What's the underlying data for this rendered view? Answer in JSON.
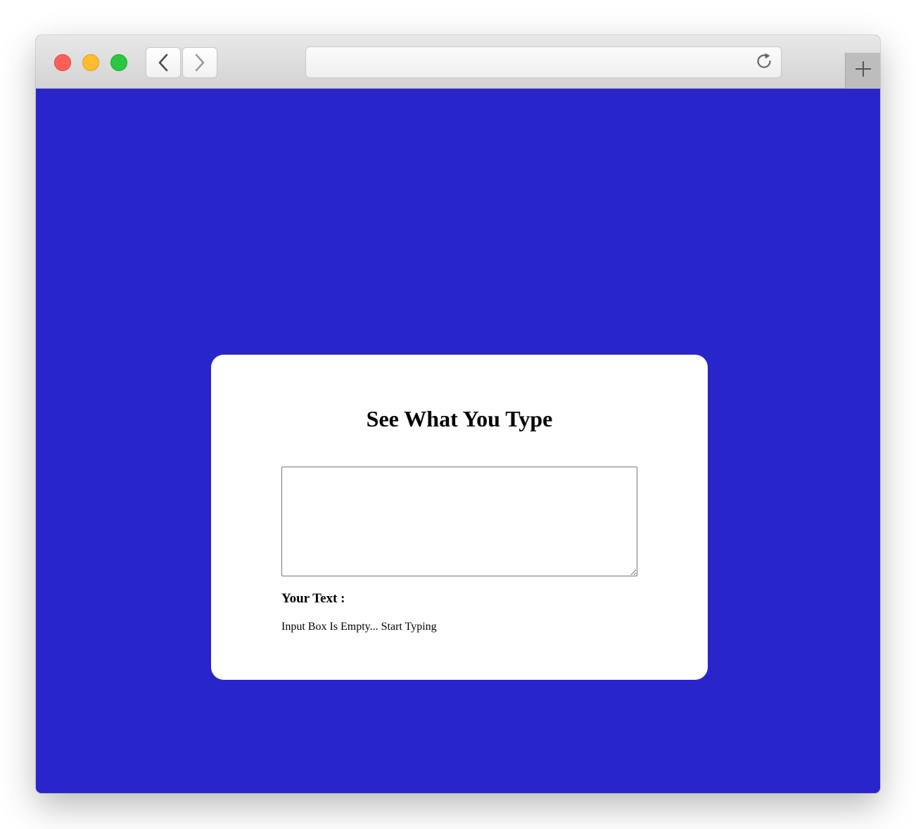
{
  "browser": {
    "url": "",
    "icons": {
      "close": "close-window-icon",
      "minimize": "minimize-window-icon",
      "maximize": "maximize-window-icon",
      "back": "chevron-left-icon",
      "forward": "chevron-right-icon",
      "reload": "reload-icon",
      "new_tab": "plus-icon"
    },
    "colors": {
      "close": "#fe5f57",
      "minimize": "#febc2e",
      "maximize": "#28c840"
    }
  },
  "page": {
    "background_color": "#2826cb",
    "card_color": "#ffffff",
    "title": "See What You Type",
    "input": {
      "value": "",
      "placeholder": ""
    },
    "output_label": "Your Text :",
    "output_text": "Input Box Is Empty... Start Typing"
  }
}
